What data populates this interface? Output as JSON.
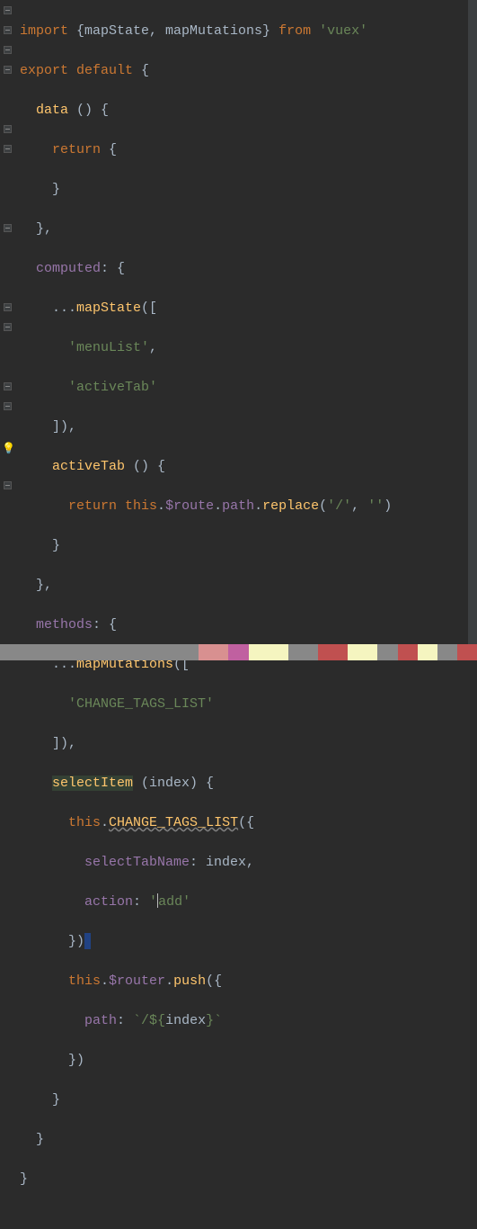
{
  "code": {
    "l1": {
      "a": "import",
      "b": " {mapState, mapMutations} ",
      "c": "from",
      "d": " 'vuex'"
    },
    "l2": {
      "a": "export default",
      "b": " {"
    },
    "l3": {
      "a": "  data ",
      "b": "() {"
    },
    "l4": {
      "a": "    ",
      "b": "return",
      "c": " {"
    },
    "l5": "    }",
    "l6": "  },",
    "l7": {
      "a": "  ",
      "b": "computed",
      "c": ": {"
    },
    "l8": {
      "a": "    ...",
      "b": "mapState",
      "c": "(["
    },
    "l9": {
      "a": "      ",
      "b": "'menuList'",
      "c": ","
    },
    "l10": {
      "a": "      ",
      "b": "'activeTab'"
    },
    "l11": "    ]),",
    "l12": {
      "a": "    ",
      "b": "activeTab ",
      "c": "() {"
    },
    "l13": {
      "a": "      ",
      "b": "return this",
      "c": ".",
      "d": "$route",
      "e": ".",
      "f": "path",
      "g": ".",
      "h": "replace",
      "i": "(",
      "j": "'/'",
      "k": ", ",
      "l": "''",
      "m": ")"
    },
    "l14": "    }",
    "l15": "  },",
    "l16": {
      "a": "  ",
      "b": "methods",
      "c": ": {"
    },
    "l17": {
      "a": "    ...",
      "b": "mapMutations",
      "c": "(["
    },
    "l18": {
      "a": "      ",
      "b": "'CHANGE_TAGS_LIST'"
    },
    "l19": "    ]),",
    "l20": {
      "a": "    ",
      "b": "selectItem",
      "c": " (index) {"
    },
    "l21": {
      "a": "      ",
      "b": "this",
      "c": ".",
      "d": "CHANGE_TAGS_LIST",
      "e": "({"
    },
    "l22": {
      "a": "        ",
      "b": "selectTabName",
      "c": ": index,"
    },
    "l23": {
      "a": "        ",
      "b": "action",
      "c": ": ",
      "d": "'",
      "e": "add'"
    },
    "l24": "      })",
    "l25": {
      "a": "      ",
      "b": "this",
      "c": ".",
      "d": "$router",
      "e": ".",
      "f": "push",
      "g": "({"
    },
    "l26": {
      "a": "        ",
      "b": "path",
      "c": ": ",
      "d": "`/${",
      "e": "index",
      "f": "}`"
    },
    "l27": "      })",
    "l28": "    }",
    "l29": "  }",
    "l30": "}"
  },
  "gutter": {
    "fold_positions": [
      1,
      2,
      3,
      4,
      7,
      8,
      12,
      16,
      17,
      20,
      21,
      25
    ],
    "bulb_line": 23
  }
}
